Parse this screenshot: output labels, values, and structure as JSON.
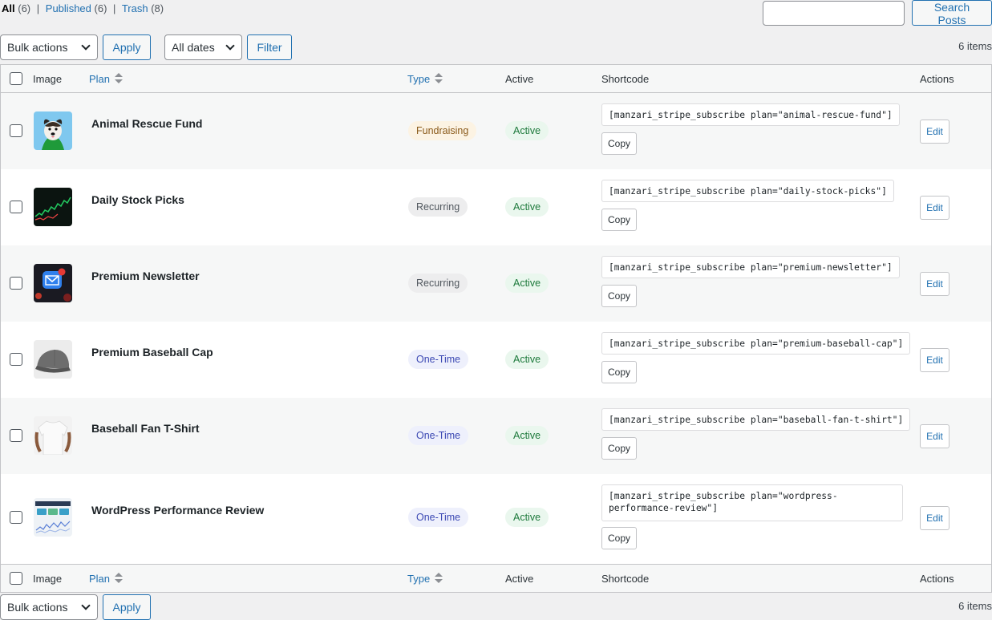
{
  "status_links": {
    "all_label": "All",
    "all_count": "(6)",
    "published_label": "Published",
    "published_count": "(6)",
    "trash_label": "Trash",
    "trash_count": "(8)",
    "separator": "|"
  },
  "search": {
    "value": "",
    "button_label": "Search Posts"
  },
  "top_nav": {
    "bulk_label": "Bulk actions",
    "apply_label": "Apply",
    "dates_label": "All dates",
    "filter_label": "Filter",
    "items_count": "6 items"
  },
  "columns": {
    "image": "Image",
    "plan": "Plan",
    "type": "Type",
    "active": "Active",
    "shortcode": "Shortcode",
    "actions": "Actions"
  },
  "rows": [
    {
      "name": "Animal Rescue Fund",
      "type": "Fundraising",
      "status": "Active",
      "shortcode": "[manzari_stripe_subscribe plan=\"animal-rescue-fund\"]",
      "copy": "Copy",
      "edit": "Edit"
    },
    {
      "name": "Daily Stock Picks",
      "type": "Recurring",
      "status": "Active",
      "shortcode": "[manzari_stripe_subscribe plan=\"daily-stock-picks\"]",
      "copy": "Copy",
      "edit": "Edit"
    },
    {
      "name": "Premium Newsletter",
      "type": "Recurring",
      "status": "Active",
      "shortcode": "[manzari_stripe_subscribe plan=\"premium-newsletter\"]",
      "copy": "Copy",
      "edit": "Edit"
    },
    {
      "name": "Premium Baseball Cap",
      "type": "One-Time",
      "status": "Active",
      "shortcode": "[manzari_stripe_subscribe plan=\"premium-baseball-cap\"]",
      "copy": "Copy",
      "edit": "Edit"
    },
    {
      "name": "Baseball Fan T-Shirt",
      "type": "One-Time",
      "status": "Active",
      "shortcode": "[manzari_stripe_subscribe plan=\"baseball-fan-t-shirt\"]",
      "copy": "Copy",
      "edit": "Edit"
    },
    {
      "name": "WordPress Performance Review",
      "type": "One-Time",
      "status": "Active",
      "shortcode": "[manzari_stripe_subscribe plan=\"wordpress-performance-review\"]",
      "copy": "Copy",
      "edit": "Edit"
    }
  ],
  "bottom_nav": {
    "bulk_label": "Bulk actions",
    "apply_label": "Apply",
    "items_count": "6 items"
  },
  "colors": {
    "link": "#2271b1",
    "fundraising_bg": "#fcf3e3",
    "recurring_bg": "#ededee",
    "one_time_bg": "#eef0fc",
    "active_bg": "#eaf7ee",
    "active_text": "#1e7a3c"
  }
}
